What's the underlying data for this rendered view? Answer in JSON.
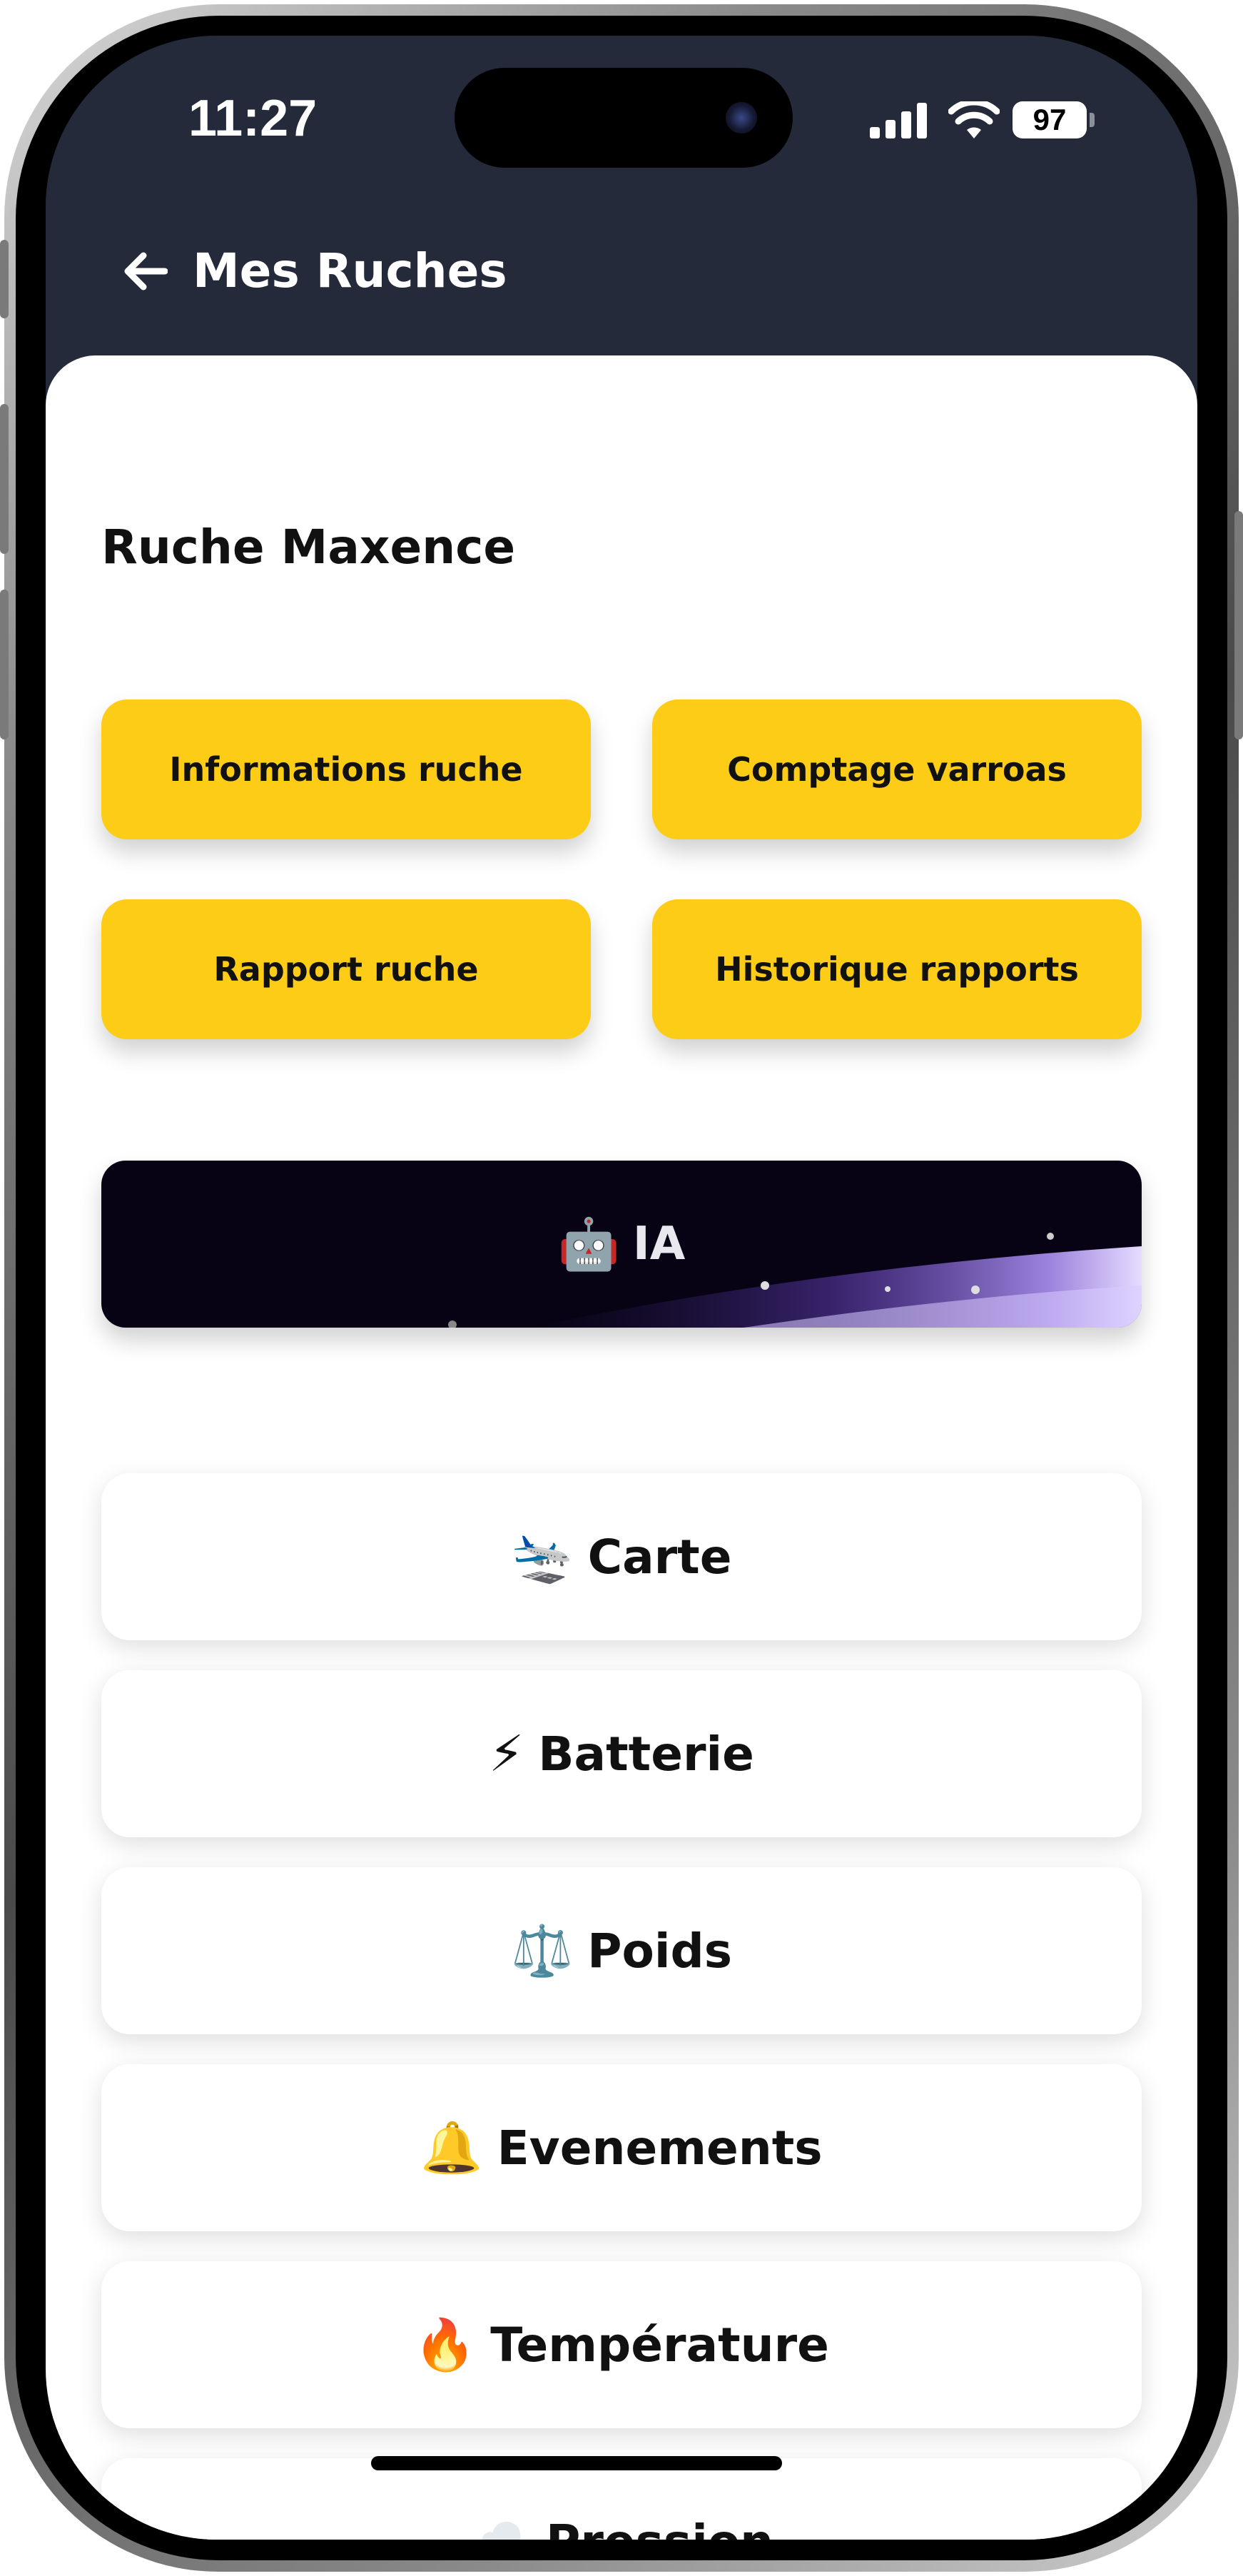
{
  "status_bar": {
    "time": "11:27",
    "battery": "97"
  },
  "nav": {
    "title": "Mes Ruches"
  },
  "page": {
    "title": "Ruche Maxence"
  },
  "actions": [
    "Informations ruche",
    "Comptage varroas",
    "Rapport ruche",
    "Historique rapports"
  ],
  "ia": {
    "emoji": "🤖",
    "label": "IA"
  },
  "menu": [
    {
      "emoji": "🛬",
      "label": "Carte"
    },
    {
      "emoji": "⚡",
      "label": "Batterie"
    },
    {
      "emoji": "⚖️",
      "label": "Poids"
    },
    {
      "emoji": "🔔",
      "label": "Evenements"
    },
    {
      "emoji": "🔥",
      "label": "Température"
    },
    {
      "emoji": "☁️",
      "label": "Pression"
    }
  ],
  "colors": {
    "header": "#242a3a",
    "accent_yellow": "#fdcc17",
    "ia_bg": "#070314"
  },
  "icons": {
    "back": "arrow-left-icon",
    "signal": "signal-icon",
    "wifi": "wifi-icon",
    "battery": "battery-icon"
  }
}
